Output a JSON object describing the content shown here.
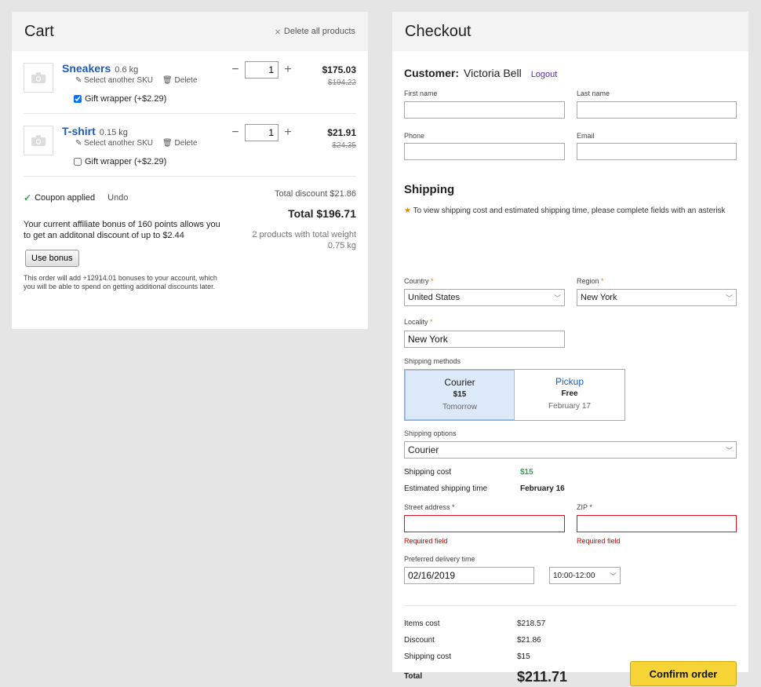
{
  "cart": {
    "title": "Cart",
    "delete_all": "Delete all products",
    "items": [
      {
        "name": "Sneakers",
        "weight": "0.6 kg",
        "select_sku": "Select another SKU",
        "delete": "Delete",
        "gift": "Gift wrapper (+$2.29)",
        "gift_checked": true,
        "qty": "1",
        "price": "$175.03",
        "old_price": "$194.22"
      },
      {
        "name": "T-shirt",
        "weight": "0.15 kg",
        "select_sku": "Select another SKU",
        "delete": "Delete",
        "gift": "Gift wrapper (+$2.29)",
        "gift_checked": false,
        "qty": "1",
        "price": "$21.91",
        "old_price": "$24.35"
      }
    ],
    "coupon": "Coupon applied",
    "undo": "Undo",
    "total_discount": "Total discount $21.86",
    "total": "Total $196.71",
    "weight_summary": "2 products with total weight 0.75 kg",
    "affiliate_text": "Your current affiliate bonus of 160 points allows you to get an additonal discount of up to $2.44",
    "use_bonus": "Use bonus",
    "bonus_note": "This order will add +12914.01 bonuses to your account, which you will be able to spend on getting additional discounts later."
  },
  "checkout": {
    "title": "Checkout",
    "customer_label": "Customer:",
    "customer_name": "Victoria Bell",
    "logout": "Logout",
    "first_name_label": "First name",
    "last_name_label": "Last name",
    "phone_label": "Phone",
    "email_label": "Email",
    "shipping_title": "Shipping",
    "shipping_note": "To view shipping cost and estimated shipping time, please complete fields with an asterisk",
    "country_label": "Country",
    "country_value": "United States",
    "region_label": "Region",
    "region_value": "New York",
    "locality_label": "Locality",
    "locality_value": "New York",
    "methods_label": "Shipping methods",
    "methods": [
      {
        "name": "Courier",
        "price": "$15",
        "date": "Tomorrow"
      },
      {
        "name": "Pickup",
        "price": "Free",
        "date": "February 17"
      }
    ],
    "options_label": "Shipping options",
    "options_value": "Courier",
    "cost_label": "Shipping cost",
    "cost_value": "$15",
    "est_label": "Estimated shipping time",
    "est_value": "February 16",
    "street_label": "Street address",
    "zip_label": "ZIP",
    "required": "Required field",
    "delivery_label": "Preferred delivery time",
    "delivery_date": "02/16/2019",
    "delivery_slot": "10:00-12:00",
    "items_cost_label": "Items cost",
    "items_cost": "$218.57",
    "discount_label": "Discount",
    "discount": "$21.86",
    "ship_cost_label": "Shipping cost",
    "ship_cost": "$15",
    "total_label": "Total",
    "total": "$211.71",
    "confirm": "Confirm order"
  },
  "colors": {
    "accent": "#1a5bc0",
    "confirm_bg": "#f7d436",
    "error": "#d12",
    "success": "#2aa84a"
  }
}
